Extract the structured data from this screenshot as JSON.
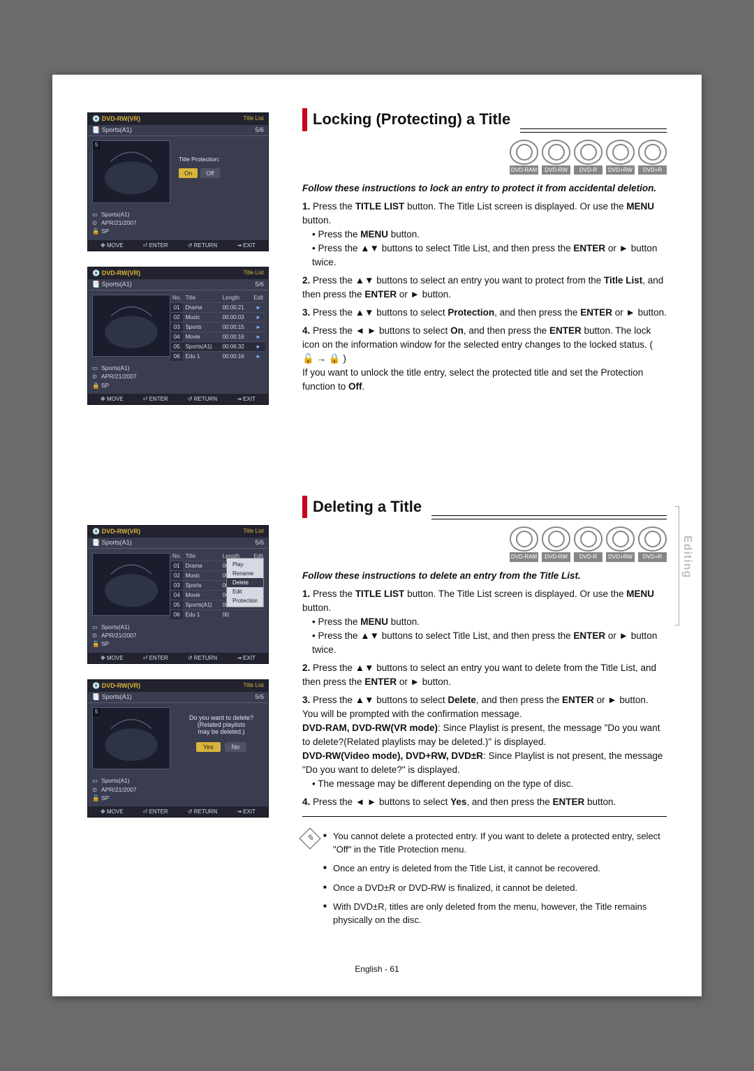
{
  "discs": [
    "DVD-RAM",
    "DVD-RW",
    "DVD-R",
    "DVD+RW",
    "DVD+R"
  ],
  "osd": {
    "disc": "DVD-RW(VR)",
    "screen": "Title List",
    "entry": "Sports(A1)",
    "page": "5/6",
    "date": "APR/21/2007",
    "quality": "SP",
    "protection_label": "Title Protection:",
    "on": "On",
    "off": "Off",
    "move": "MOVE",
    "enter": "ENTER",
    "return": "RETURN",
    "exit": "EXIT",
    "cols": {
      "no": "No.",
      "title": "Title",
      "length": "Length",
      "edit": "Edit"
    },
    "rows": [
      {
        "no": "01",
        "title": "Drama",
        "length": "00:00:21"
      },
      {
        "no": "02",
        "title": "Music",
        "length": "00:00:03"
      },
      {
        "no": "03",
        "title": "Sports",
        "length": "00:00:15"
      },
      {
        "no": "04",
        "title": "Movie",
        "length": "00:00:16"
      },
      {
        "no": "05",
        "title": "Sports(A1)",
        "length": "00:06:32"
      },
      {
        "no": "06",
        "title": "Edu 1",
        "length": "00:00:16"
      }
    ],
    "popup": [
      "Rename",
      "Delete",
      "Edit",
      "Protection"
    ],
    "popup_labels": {
      "rename": "Rename",
      "delete": "Delete",
      "edit": "Edit",
      "protection": "Protection",
      "play": "Play"
    },
    "confirm_msg1": "Do you want to delete?",
    "confirm_msg2": "(Related playlists",
    "confirm_msg3": "may be deleted.)",
    "yes": "Yes",
    "no_btn": "No"
  },
  "lock": {
    "heading": "Locking (Protecting) a Title",
    "intro": "Follow these instructions to lock an entry to protect it from accidental deletion.",
    "s1a": "Press the ",
    "s1b": "TITLE LIST",
    "s1c": " button. The Title List screen is displayed. Or use the ",
    "s1d": "MENU",
    "s1e": " button.",
    "s1f": "Press the ",
    "s1g": "MENU",
    "s1h": " button.",
    "s1i": "Press the ▲▼ buttons to select Title List, and then press the ",
    "s1j": "ENTER",
    "s1k": " or ► button twice.",
    "s2a": "Press the ▲▼ buttons to select an entry you want to protect from the ",
    "s2b": "Title List",
    "s2c": ", and then press the ",
    "s2d": "ENTER",
    "s2e": " or ► button.",
    "s3a": "Press the ▲▼ buttons to select ",
    "s3b": "Protection",
    "s3c": ", and then press the ",
    "s3d": "ENTER",
    "s3e": " or ► button.",
    "s4a": "Press the ◄ ► buttons to select ",
    "s4b": "On",
    "s4c": ", and then press the ",
    "s4d": "ENTER",
    "s4e": " button. The lock icon on the information window for the selected entry changes to the locked status. ( 🔓 → 🔒 )",
    "s4f": "If you want to unlock the title entry, select the protected title and set the Protection function to ",
    "s4g": "Off",
    "s4h": "."
  },
  "del": {
    "heading": "Deleting a Title",
    "intro": "Follow these instructions to delete an entry from the Title List.",
    "s1a": "Press the ",
    "s1b": "TITLE LIST",
    "s1c": " button. The Title List screen is displayed. Or use the ",
    "s1d": "MENU",
    "s1e": " button.",
    "s1f": "Press the ",
    "s1g": "MENU",
    "s1h": " button.",
    "s1i": "Press the ▲▼ buttons to select Title List, and then press the ",
    "s1j": "ENTER",
    "s1k": " or ► button twice.",
    "s2a": "Press the ▲▼ buttons to select an entry you want to  delete from the Title List, and then press the ",
    "s2b": "ENTER",
    "s2c": " or ► button.",
    "s3a": "Press the ▲▼ buttons to select ",
    "s3b": "Delete",
    "s3c": ", and then press the ",
    "s3d": "ENTER",
    "s3e": " or ► button.",
    "s3f": "You will be prompted with the confirmation message.",
    "s3g1": "DVD-RAM, DVD-RW(VR mode)",
    "s3g2": ": Since Playlist is present, the message \"Do you want to delete?(Related playlists may be deleted.)\" is displayed.",
    "s3h1": "DVD-RW(Video mode), DVD+RW, DVD±R",
    "s3h2": ": Since Playlist is not present, the message \"Do you want to delete?\" is displayed.",
    "s3i": "The message may be different depending on the type of disc.",
    "s4a": "Press the ◄ ► buttons to select ",
    "s4b": "Yes",
    "s4c": ", and then press the ",
    "s4d": "ENTER",
    "s4e": " button."
  },
  "notes": {
    "n1": "You cannot delete a protected entry. If you want to delete a protected entry, select \"Off\" in the Title Protection menu.",
    "n2": "Once an entry is deleted from the Title List, it cannot be recovered.",
    "n3": "Once a DVD±R or DVD-RW is finalized, it cannot be deleted.",
    "n4": "With DVD±R, titles are only deleted from the menu, however, the Title remains physically on the disc."
  },
  "side": "Editing",
  "footer_lang": "English - ",
  "footer_page": "61"
}
